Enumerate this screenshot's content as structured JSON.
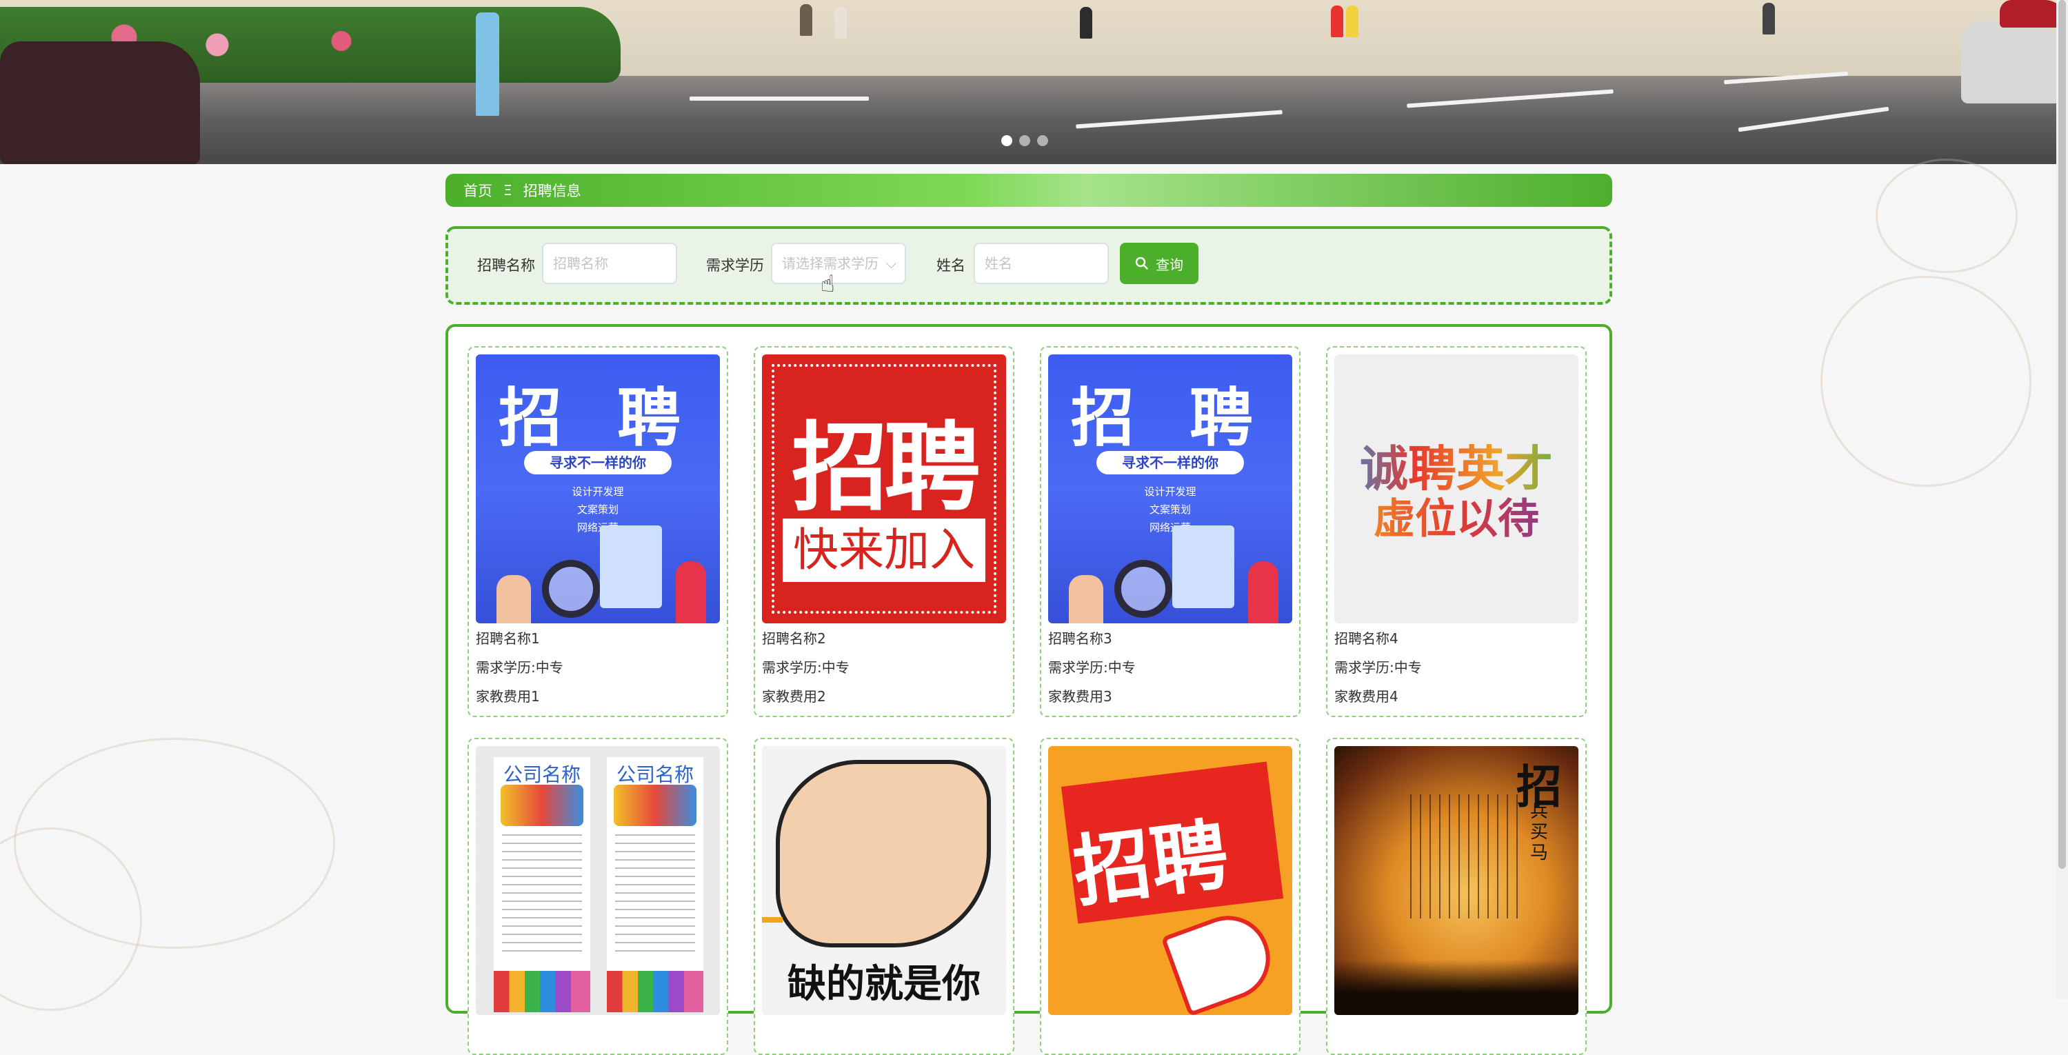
{
  "banner": {
    "carousel_dots": 3,
    "active_dot": 1
  },
  "breadcrumb": {
    "home": "首页",
    "separator": "Ξ",
    "current": "招聘信息"
  },
  "search": {
    "fields": [
      {
        "label": "招聘名称",
        "placeholder": "招聘名称"
      },
      {
        "label": "需求学历",
        "placeholder": "请选择需求学历"
      },
      {
        "label": "姓名",
        "placeholder": "姓名"
      }
    ],
    "button_label": "查询",
    "button_icon": "search-icon"
  },
  "cards": [
    {
      "name": "招聘名称1",
      "education": "需求学历:中专",
      "fee": "家教费用1",
      "poster": {
        "headline": "招 聘",
        "pill": "寻求不一样的你",
        "lines": [
          "设计开发理",
          "文案策划",
          "网络运营"
        ]
      }
    },
    {
      "name": "招聘名称2",
      "education": "需求学历:中专",
      "fee": "家教费用2",
      "poster": {
        "headline": "招聘",
        "box": "快来加入"
      }
    },
    {
      "name": "招聘名称3",
      "education": "需求学历:中专",
      "fee": "家教费用3",
      "poster": {
        "headline": "招 聘",
        "pill": "寻求不一样的你",
        "lines": [
          "设计开发理",
          "文案策划",
          "网络运营"
        ]
      }
    },
    {
      "name": "招聘名称4",
      "education": "需求学历:中专",
      "fee": "家教费用4",
      "poster": {
        "line1": "诚聘英才",
        "line2": "虚位以待"
      }
    },
    {
      "poster": {
        "name": "公司名称"
      }
    },
    {
      "poster": {
        "headline": "缺的就是你"
      }
    },
    {
      "poster": {
        "headline": "招聘"
      }
    },
    {
      "poster": {
        "headline": "招",
        "sub": "兵买马"
      }
    }
  ],
  "colors": {
    "accent": "#4caf2c",
    "breadcrumb_light": "#a6e38a",
    "search_bg": "#eaf4e6",
    "card_border": "#8fd27a"
  }
}
